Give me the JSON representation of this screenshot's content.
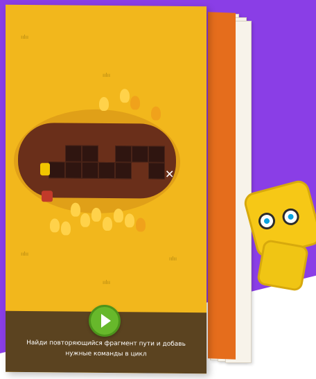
{
  "game": {
    "hint_text": "Найди повторяющийся фрагмент пути и добавь нужные команды в цикл"
  },
  "colors": {
    "background_purple": "#8a3ee6",
    "card_yellow": "#f2b71c",
    "dirt_brown": "#6a2f1a",
    "play_green": "#67b82b"
  },
  "icons": {
    "play": "play-icon",
    "target": "x-icon",
    "robot": "robot-icon"
  }
}
